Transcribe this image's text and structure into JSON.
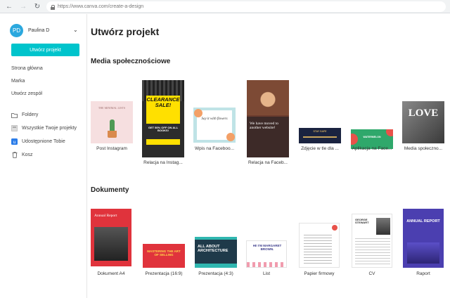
{
  "browser": {
    "url": "https://www.canva.com/create-a-design"
  },
  "sidebar": {
    "user_initials": "PD",
    "user_name": "Paulina D",
    "create_button": "Utwórz projekt",
    "links": [
      "Strona główna",
      "Marka",
      "Utwórz zespół"
    ],
    "folders": {
      "folders": "Foldery",
      "all_projects": "Wszystkie Twoje projekty",
      "shared": "Udostępnione Tobie",
      "trash": "Kosz"
    }
  },
  "main": {
    "title": "Utwórz projekt",
    "social": {
      "heading": "Media społecznościowe",
      "items": [
        {
          "label": "Post Instagram",
          "thumb_text": "THE MINIMAL LISTS"
        },
        {
          "label": "Relacja na Instag...",
          "thumb_text": "CLEARANCE SALE!",
          "thumb_sub": "GET 50% OFF ON ALL BOOKS!"
        },
        {
          "label": "Wpis na Faceboo...",
          "thumb_text": "Say it with flowers"
        },
        {
          "label": "Relacja na Faceb...",
          "thumb_text": "We have moved to another website!"
        },
        {
          "label": "Zdjęcie w tle dla ...",
          "thumb_text": "STAY SAFE"
        },
        {
          "label": "Aplikacja na Face...",
          "thumb_text": "WATERMELON"
        },
        {
          "label": "Media społeczno...",
          "thumb_text": "LOVE"
        }
      ]
    },
    "documents": {
      "heading": "Dokumenty",
      "items": [
        {
          "label": "Dokument A4",
          "thumb_text": "Annual Report"
        },
        {
          "label": "Prezentacja (16:9)",
          "thumb_text": "MASTERING THE ART OF SELLING"
        },
        {
          "label": "Prezentacja (4:3)",
          "thumb_text": "ALL ABOUT ARCHITECTURE"
        },
        {
          "label": "List",
          "thumb_text": "HI! I'M MARGARET BROWN."
        },
        {
          "label": "Papier firmowy",
          "thumb_text": ""
        },
        {
          "label": "CV",
          "thumb_text": "GEORGE STEWART"
        },
        {
          "label": "Raport",
          "thumb_text": "ANNUAL REPORT"
        }
      ]
    }
  },
  "colors": {
    "accent": "#00c4cc",
    "avatar": "#2ba8de"
  }
}
